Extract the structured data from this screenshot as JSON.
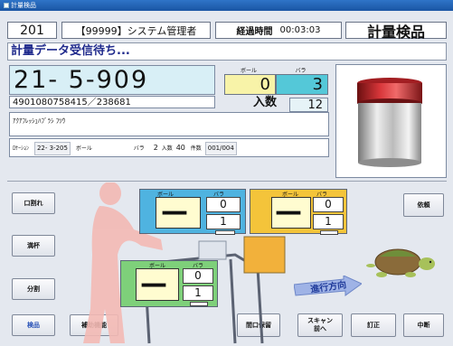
{
  "window": {
    "title": "計量検品"
  },
  "header": {
    "station": "201",
    "user": "【99999】システム管理者",
    "elapsed_label": "経過時間",
    "elapsed_value": "00:03:03",
    "mode": "計量検品"
  },
  "status_message": "計量データ受信待ち...",
  "item": {
    "location_code": "21-  5-909",
    "ball_label": "ボール",
    "bara_label": "バラ",
    "ball_value": "0",
    "bara_value": "3",
    "barcode": "4901080758415／238681",
    "irisu_label": "入数",
    "irisu_value": "12",
    "name": "ｱｸｱﾌﾚｯｼｭﾊﾌﾞﾗｼ ﾌﾂｳ",
    "loc_label": "ﾛｹｰｼｮﾝ",
    "loc_value": "22-  3-205",
    "ball2_label": "ボール",
    "bara2_label": "バラ",
    "bara2_value": "2",
    "irisu2_label": "入数",
    "irisu2_value": "40",
    "count_label": "件数",
    "count_value": "001/004"
  },
  "buttons": {
    "kuchiware": "口割れ",
    "manpai": "満杯",
    "bunkatsu": "分割",
    "kenpin": "検品",
    "hojo": "補助機能",
    "izure": "依頼",
    "hatsukuchi": "間口保留",
    "scan_line1": "スキャン",
    "scan_line2": "前へ",
    "teisei": "訂正",
    "chudan": "中断"
  },
  "displays": [
    {
      "ball_label": "ボール",
      "bara_label": "バラ",
      "dash": "—",
      "top": "0",
      "bottom": "1",
      "color": "#4fb3e0"
    },
    {
      "ball_label": "ボール",
      "bara_label": "バラ",
      "dash": "—",
      "top": "0",
      "bottom": "1",
      "color": "#f4c43a"
    },
    {
      "ball_label": "ボール",
      "bara_label": "バラ",
      "dash": "—",
      "top": "0",
      "bottom": "1",
      "color": "#7ed07a"
    }
  ],
  "direction_label": "進行方向"
}
